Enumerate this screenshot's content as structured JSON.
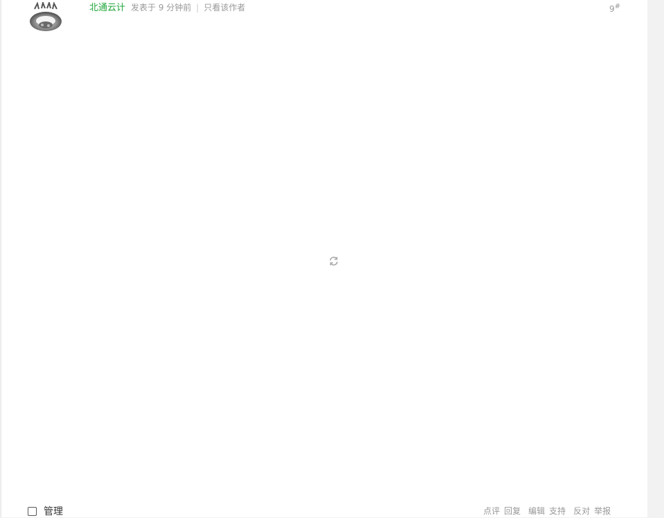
{
  "post": {
    "author": "北通云计",
    "posted_time": "发表于 9 分钟前",
    "separator": "|",
    "only_author": "只看该作者",
    "floor_number": "9",
    "floor_suffix": "#"
  },
  "footer": {
    "manage_label": "管理",
    "manage_checked": false,
    "actions": {
      "comment": "点评",
      "reply": "回复",
      "edit": "编辑",
      "support": "支持",
      "oppose": "反对",
      "report": "举报"
    }
  },
  "icons": {
    "avatar": "antler-helmet-avatar-icon",
    "loading": "refresh-loading-icon"
  },
  "colors": {
    "author": "#20a53a",
    "muted_text": "#999999",
    "background": "#f2f2f2"
  }
}
